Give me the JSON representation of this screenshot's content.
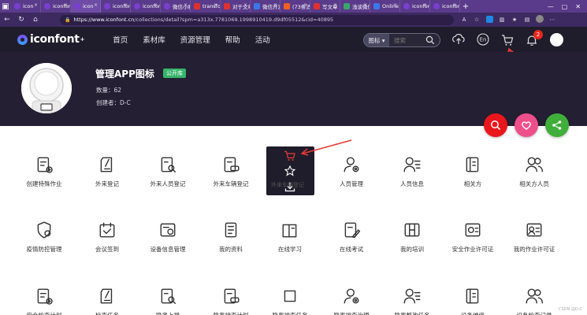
{
  "browser": {
    "tabs": [
      {
        "label": "icon",
        "fav": "purple"
      },
      {
        "label": "iconfont",
        "fav": "purple"
      },
      {
        "label": "icon",
        "fav": "purple",
        "active": true
      },
      {
        "label": "iconfont",
        "fav": "purple"
      },
      {
        "label": "iconfont",
        "fav": "purple"
      },
      {
        "label": "微信小程",
        "fav": "purple"
      },
      {
        "label": "transform",
        "fav": "red"
      },
      {
        "label": "对于文章",
        "fav": "red"
      },
      {
        "label": "微信开发",
        "fav": "blue"
      },
      {
        "label": "(73条消息",
        "fav": "orange"
      },
      {
        "label": "写文章",
        "fav": "red"
      },
      {
        "label": "浅谈微信",
        "fav": "green"
      },
      {
        "label": "Online",
        "fav": "blue"
      },
      {
        "label": "iconfont",
        "fav": "purple"
      },
      {
        "label": "iconfont",
        "fav": "purple"
      }
    ],
    "new_tab": "+",
    "url_host": "https://www.iconfont.cn",
    "url_path": "/collections/detail?spm=a313x.7781069.1998910419.d9df05512&cid=40895"
  },
  "site": {
    "logo_text": "iconfont",
    "nav": [
      "首页",
      "素材库",
      "资源管理",
      "帮助",
      "活动"
    ],
    "search_type": "图标",
    "search_placeholder": "搜索",
    "cart_count": "2"
  },
  "collection": {
    "title": "管理APP图标",
    "badge": "公开库",
    "count_line": "数量：62",
    "creator_line": "创建者：D-C"
  },
  "popup_ghost_label": "外来车辆登记",
  "icons_row1": [
    "创建特殊作业",
    "外来登记",
    "外来人员登记",
    "外来车辆登记",
    "",
    "人员管理",
    "人员信息",
    "相关方",
    "相关方人员"
  ],
  "icons_row2": [
    "疫情防控管理",
    "会议签到",
    "设备信息管理",
    "我的资料",
    "在线学习",
    "在线考试",
    "我的培训",
    "安全作业许可证",
    "我的作业许可证"
  ],
  "icons_row3": [
    "安全检查计划",
    "检查任务",
    "隐患上报",
    "隐患排查计划",
    "隐患排查任务",
    "隐患排查治理",
    "隐患整改任务",
    "设备维修",
    "设备检查记录"
  ],
  "watermark": "CSDN @D-C"
}
